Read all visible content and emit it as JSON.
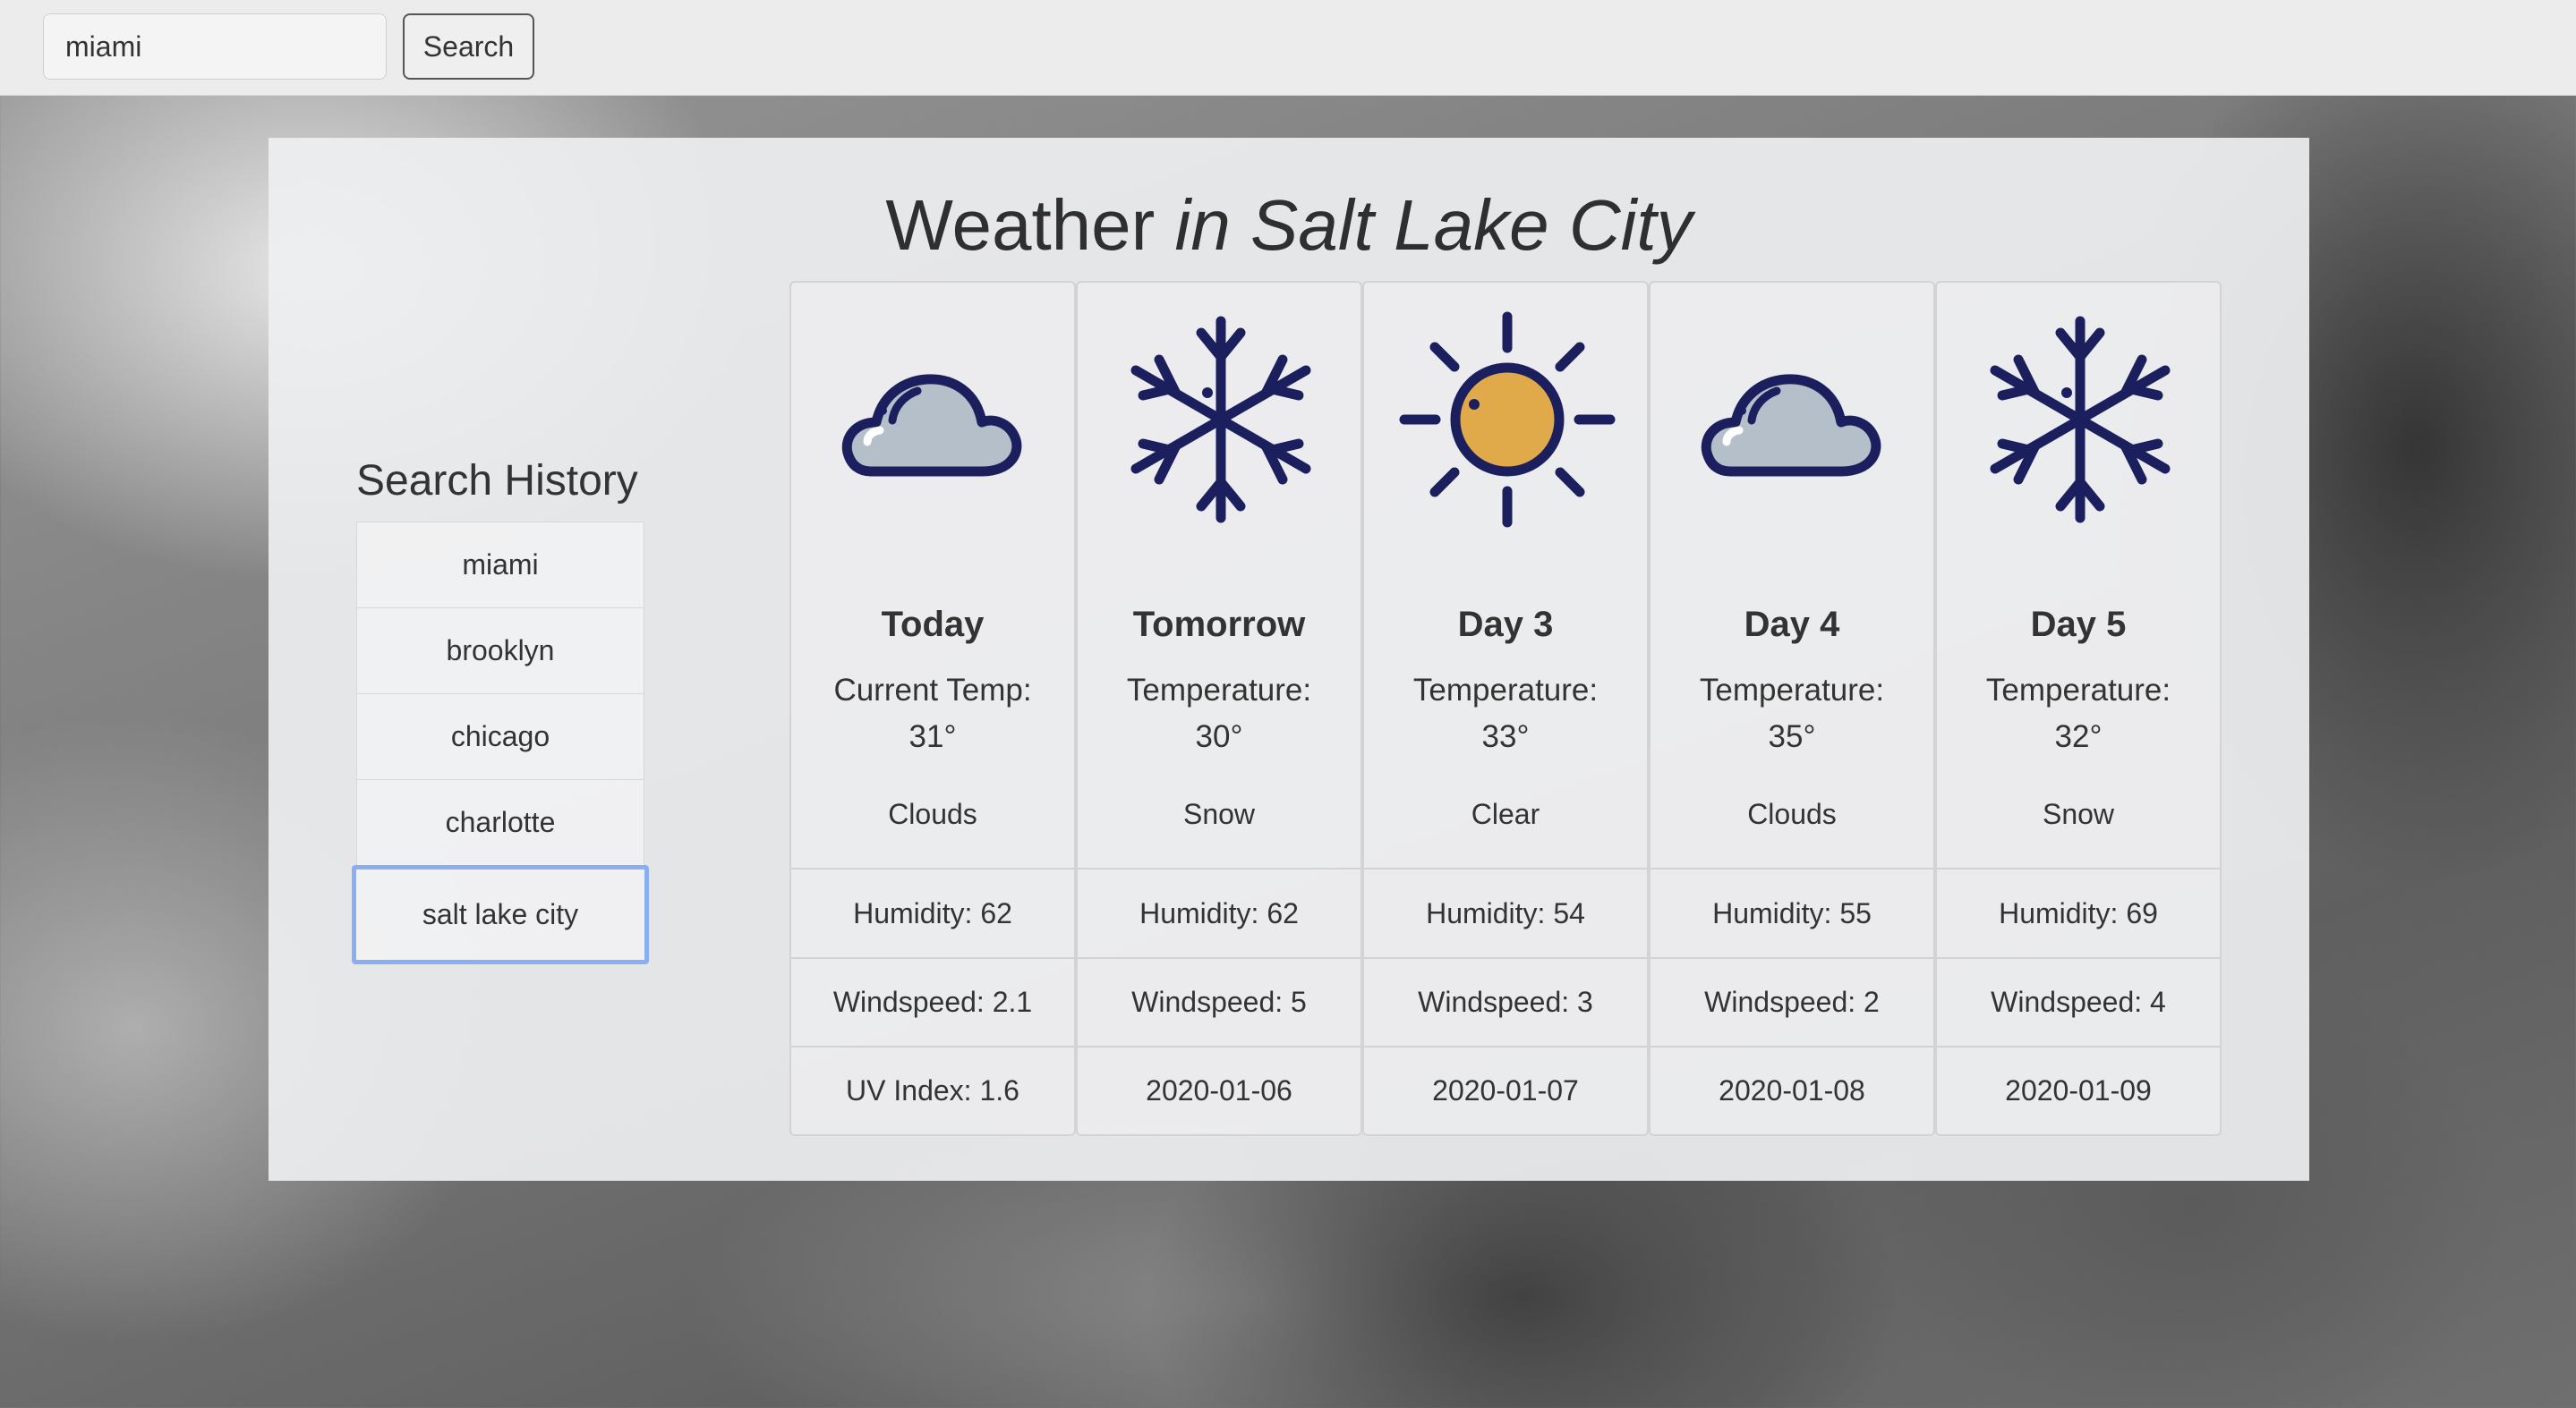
{
  "search": {
    "value": "miami",
    "button_label": "Search"
  },
  "title": {
    "prefix": "Weather",
    "city": "in Salt Lake City"
  },
  "history": {
    "heading": "Search History",
    "items": [
      "miami",
      "brooklyn",
      "chicago",
      "charlotte",
      "salt lake city"
    ],
    "active": "salt lake city"
  },
  "forecast": [
    {
      "day": "Today",
      "temp_label": "Current Temp:",
      "temp": "31°",
      "condition": "Clouds",
      "icon": "cloud-icon",
      "humidity": "Humidity: 62",
      "windspeed": "Windspeed: 2.1",
      "extra": "UV Index: 1.6"
    },
    {
      "day": "Tomorrow",
      "temp_label": "Temperature:",
      "temp": "30°",
      "condition": "Snow",
      "icon": "snowflake-icon",
      "humidity": "Humidity: 62",
      "windspeed": "Windspeed: 5",
      "extra": "2020-01-06"
    },
    {
      "day": "Day 3",
      "temp_label": "Temperature:",
      "temp": "33°",
      "condition": "Clear",
      "icon": "sun-icon",
      "humidity": "Humidity: 54",
      "windspeed": "Windspeed: 3",
      "extra": "2020-01-07"
    },
    {
      "day": "Day 4",
      "temp_label": "Temperature:",
      "temp": "35°",
      "condition": "Clouds",
      "icon": "cloud-icon",
      "humidity": "Humidity: 55",
      "windspeed": "Windspeed: 2",
      "extra": "2020-01-08"
    },
    {
      "day": "Day 5",
      "temp_label": "Temperature:",
      "temp": "32°",
      "condition": "Snow",
      "icon": "snowflake-icon",
      "humidity": "Humidity: 69",
      "windspeed": "Windspeed: 4",
      "extra": "2020-01-09"
    }
  ],
  "colors": {
    "icon_stroke": "#1b1f5e",
    "cloud_fill": "#b5bfca",
    "sun_fill": "#e0a94a",
    "history_focus": "#8aaef2"
  }
}
